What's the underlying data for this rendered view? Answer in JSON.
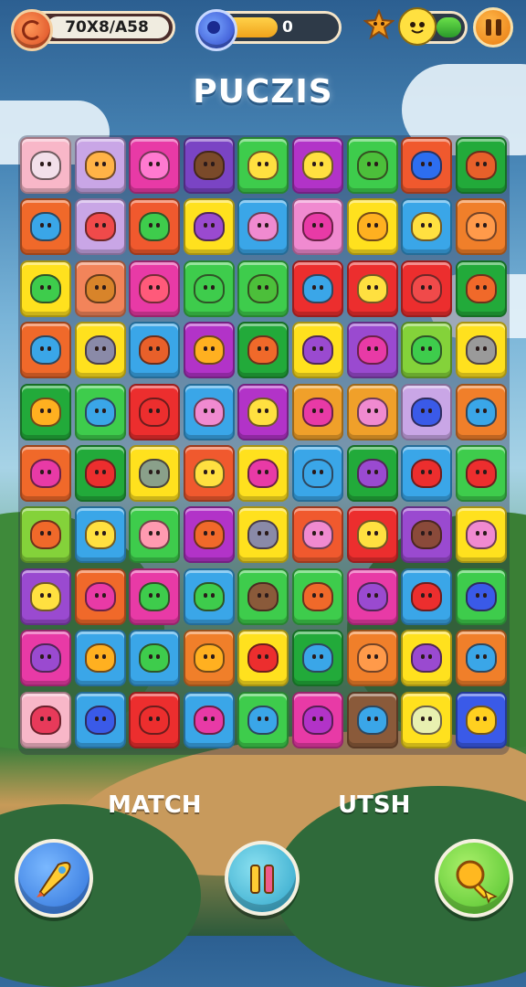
{
  "hud": {
    "score_text": "70X8/A58",
    "progress_value": "0",
    "progress_fraction": 0.55,
    "meter_fraction": 0.45,
    "icons": [
      "swirl-coin-icon",
      "blue-gem-icon",
      "star-character-icon",
      "yellow-character-icon",
      "pause-icon"
    ]
  },
  "title": "PUCZIS",
  "board": {
    "rows": 10,
    "cols": 9,
    "tiles": [
      [
        "#f8b7c8",
        "#c9a6e6",
        "#e83aa6",
        "#7a44c4",
        "#3ecc4c",
        "#b233c8",
        "#3ecc4c",
        "#f0592e",
        "#22aa3a"
      ],
      [
        "#f0692a",
        "#c9a6e6",
        "#f0592e",
        "#ffe11e",
        "#3aa6e8",
        "#f08ad0",
        "#ffe11e",
        "#3aa6e8",
        "#f07f2a"
      ],
      [
        "#ffe11e",
        "#f2845a",
        "#e83aa6",
        "#3ecc4c",
        "#3ecc4c",
        "#ec2e2e",
        "#ec2e2e",
        "#ec2e2e",
        "#22aa3a"
      ],
      [
        "#f0692a",
        "#ffe11e",
        "#3aa6e8",
        "#b233c8",
        "#22aa3a",
        "#ffe11e",
        "#9a4ad0",
        "#84d23a",
        "#ffe11e"
      ],
      [
        "#22aa3a",
        "#3ecc4c",
        "#ec2e2e",
        "#3aa6e8",
        "#b233c8",
        "#f0a02a",
        "#f0a02a",
        "#c9a6e6",
        "#f07f2a"
      ],
      [
        "#f0692a",
        "#22aa3a",
        "#ffe11e",
        "#f0592e",
        "#ffe11e",
        "#3aa6e8",
        "#22aa3a",
        "#3aa6e8",
        "#3ecc4c"
      ],
      [
        "#84d23a",
        "#3aa6e8",
        "#3ecc4c",
        "#b233c8",
        "#ffe11e",
        "#f0592e",
        "#ec2e2e",
        "#9a4ad0",
        "#ffe11e"
      ],
      [
        "#9a4ad0",
        "#f0692a",
        "#e83aa6",
        "#3aa6e8",
        "#3ecc4c",
        "#3ecc4c",
        "#e83aa6",
        "#3aa6e8",
        "#3ecc4c"
      ],
      [
        "#e83aa6",
        "#3aa6e8",
        "#3aa6e8",
        "#f07f2a",
        "#ffe11e",
        "#22aa3a",
        "#f07f2a",
        "#ffe11e",
        "#f07f2a"
      ],
      [
        "#f8b7c8",
        "#3aa6e8",
        "#ec2e2e",
        "#3aa6e8",
        "#3ecc4c",
        "#e83aa6",
        "#8a5a3a",
        "#ffe11e",
        "#3a5ae8"
      ]
    ],
    "glyph_colors": [
      [
        "#f2e0ea",
        "#ffb347",
        "#ff7ad0",
        "#7a4a2a",
        "#ffe040",
        "#ffe040",
        "#4cbf3a",
        "#2d6ef0",
        "#e8602a"
      ],
      [
        "#3aa6e8",
        "#f04a4a",
        "#3ecc4c",
        "#9a4ad0",
        "#f08ad0",
        "#e83aa6",
        "#ffb020",
        "#ffe040",
        "#ff9a4a"
      ],
      [
        "#3ecc4c",
        "#d8842a",
        "#ff5a7a",
        "#3ecc4c",
        "#4cbf3a",
        "#3aa6e8",
        "#ffe040",
        "#f04a4a",
        "#f0692a"
      ],
      [
        "#3aa6e8",
        "#8a8aa8",
        "#e8602a",
        "#ffb020",
        "#f0692a",
        "#9a4ad0",
        "#e83aa6",
        "#3ecc4c",
        "#9a9a9a"
      ],
      [
        "#ffb020",
        "#3aa6e8",
        "#ec2e2e",
        "#f08ad0",
        "#ffe040",
        "#e83aa6",
        "#f08ad0",
        "#3a5ae8",
        "#3aa6e8"
      ],
      [
        "#e83aa6",
        "#ec2e2e",
        "#8aa08a",
        "#ffe040",
        "#e83aa6",
        "#3aa6e8",
        "#9a4ad0",
        "#ec2e2e",
        "#ec2e2e"
      ],
      [
        "#f0692a",
        "#ffe040",
        "#ff9ab0",
        "#f0692a",
        "#8a8aa8",
        "#f08ad0",
        "#ffe040",
        "#8a4a3a",
        "#f08ad0"
      ],
      [
        "#ffe040",
        "#e83aa6",
        "#3ecc4c",
        "#3ecc4c",
        "#8a5a3a",
        "#f0692a",
        "#9a4ad0",
        "#ec2e2e",
        "#3a5ae8"
      ],
      [
        "#9a4ad0",
        "#ffb020",
        "#3ecc4c",
        "#ffb020",
        "#ec2e2e",
        "#3aa6e8",
        "#ff9a4a",
        "#9a4ad0",
        "#3aa6e8"
      ],
      [
        "#e83a5a",
        "#3a5ae8",
        "#ec2e2e",
        "#e83aa6",
        "#3aa6e8",
        "#b233c8",
        "#3aa6e8",
        "#e8f0b0",
        "#ffd020"
      ]
    ]
  },
  "captions": {
    "left": "MATCH",
    "right": "UTSH"
  },
  "buttons": {
    "left_icon": "rocket-icon",
    "center_icon": "bars-icon",
    "right_icon": "magnifier-icon",
    "left_color": "#2a6ed8",
    "center_color": "#2aa2c8",
    "right_color": "#4cbf2a"
  }
}
